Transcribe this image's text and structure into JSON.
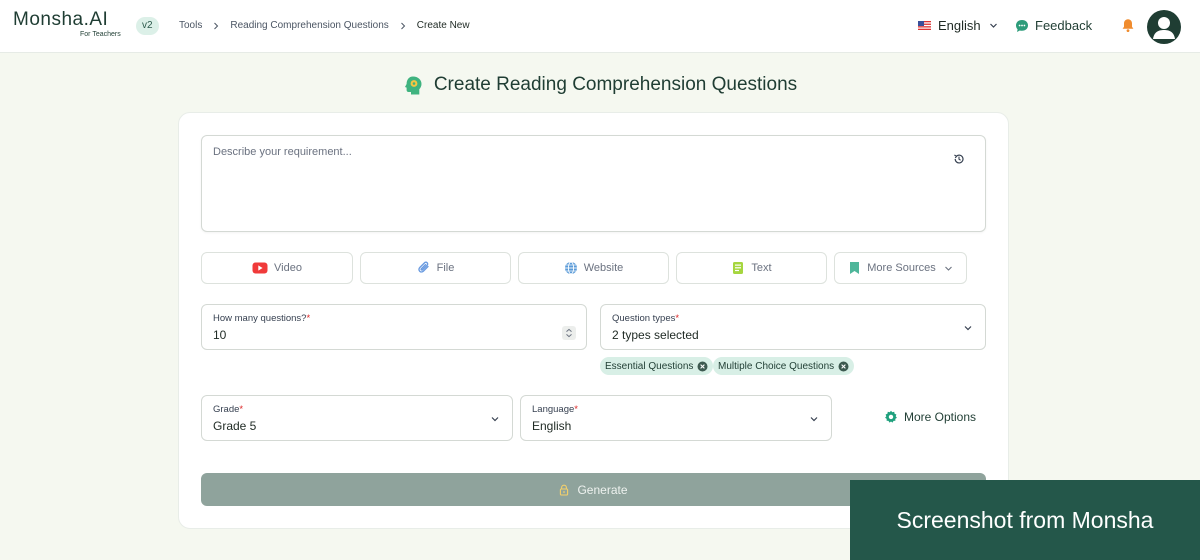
{
  "header": {
    "logo": "Monsha.AI",
    "logo_sub": "For Teachers",
    "version": "v2",
    "breadcrumb": [
      "Tools",
      "Reading Comprehension Questions",
      "Create New"
    ],
    "language": "English",
    "feedback": "Feedback"
  },
  "page": {
    "title": "Create Reading Comprehension Questions"
  },
  "prompt": {
    "placeholder": "Describe your requirement..."
  },
  "sources": [
    {
      "label": "Video",
      "icon": "youtube-icon"
    },
    {
      "label": "File",
      "icon": "paperclip-icon"
    },
    {
      "label": "Website",
      "icon": "globe-icon"
    },
    {
      "label": "Text",
      "icon": "text-document-icon"
    },
    {
      "label": "More Sources",
      "icon": "bookmark-icon"
    }
  ],
  "form": {
    "questions_label": "How many questions?",
    "questions_value": "10",
    "types_label": "Question types",
    "types_value": "2 types selected",
    "chips": [
      "Essential Questions",
      "Multiple Choice Questions"
    ],
    "grade_label": "Grade",
    "grade_value": "Grade 5",
    "language_label": "Language",
    "language_value": "English",
    "required_marker": "*",
    "more_options": "More Options"
  },
  "generate_label": "Generate",
  "watermark": "Screenshot from Monsha",
  "colors": {
    "brand_dark": "#1f3d33",
    "accent_green": "#24574a",
    "chip_bg": "#d8efe6",
    "generate_disabled": "#8fa39c",
    "page_bg": "#f5f8f0"
  }
}
